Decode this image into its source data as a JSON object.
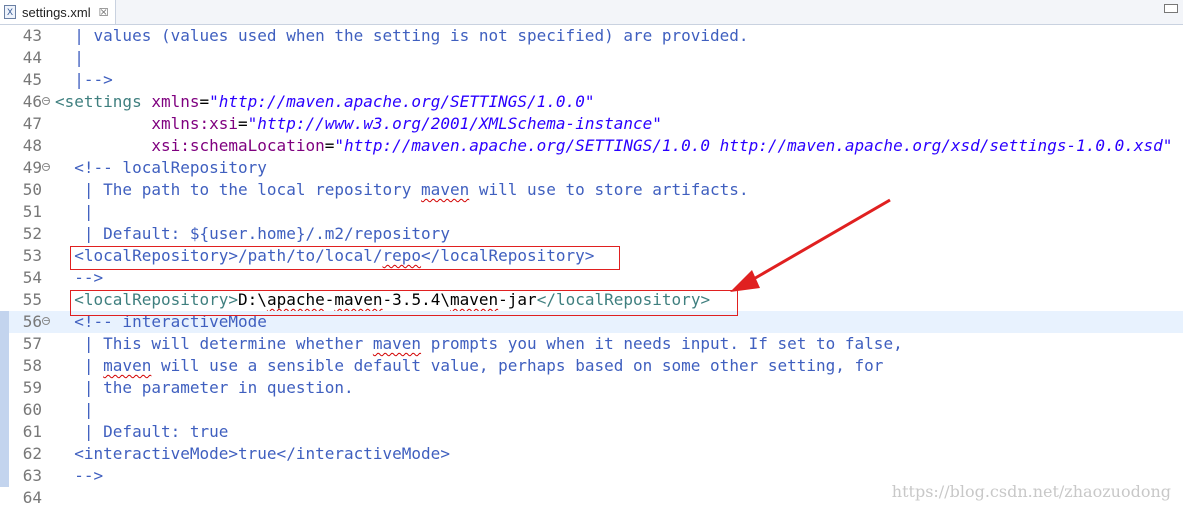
{
  "tab": {
    "label": "settings.xml",
    "close": "☒",
    "icon_letter": "X"
  },
  "lines": [
    {
      "num": "43",
      "fold": "",
      "current": false,
      "marker": false,
      "segments": [
        {
          "t": "  | values (values used when the setting is not specified) are provided.",
          "c": "c-comment"
        }
      ]
    },
    {
      "num": "44",
      "fold": "",
      "current": false,
      "marker": false,
      "segments": [
        {
          "t": "  |",
          "c": "c-comment"
        }
      ]
    },
    {
      "num": "45",
      "fold": "",
      "current": false,
      "marker": false,
      "segments": [
        {
          "t": "  |-->",
          "c": "c-comment"
        }
      ]
    },
    {
      "num": "46",
      "fold": "−",
      "current": false,
      "marker": false,
      "segments": [
        {
          "t": "<settings ",
          "c": "c-tag"
        },
        {
          "t": "xmlns",
          "c": "c-attr"
        },
        {
          "t": "=",
          "c": "c-text"
        },
        {
          "t": "\"http://maven.apache.org/SETTINGS/1.0.0\"",
          "c": "c-val"
        }
      ]
    },
    {
      "num": "47",
      "fold": "",
      "current": false,
      "marker": false,
      "segments": [
        {
          "t": "          ",
          "c": "c-text"
        },
        {
          "t": "xmlns:xsi",
          "c": "c-attr"
        },
        {
          "t": "=",
          "c": "c-text"
        },
        {
          "t": "\"http://www.w3.org/2001/XMLSchema-instance\"",
          "c": "c-val"
        }
      ]
    },
    {
      "num": "48",
      "fold": "",
      "current": false,
      "marker": false,
      "segments": [
        {
          "t": "          ",
          "c": "c-text"
        },
        {
          "t": "xsi:schemaLocation",
          "c": "c-attr"
        },
        {
          "t": "=",
          "c": "c-text"
        },
        {
          "t": "\"http://maven.apache.org/SETTINGS/1.0.0 http://maven.apache.org/xsd/settings-1.0.0.xsd\"",
          "c": "c-val"
        }
      ]
    },
    {
      "num": "49",
      "fold": "−",
      "current": false,
      "marker": false,
      "segments": [
        {
          "t": "  <!-- localRepository",
          "c": "c-comment"
        }
      ]
    },
    {
      "num": "50",
      "fold": "",
      "current": false,
      "marker": false,
      "segments": [
        {
          "t": "   | The path to the local repository ",
          "c": "c-comment"
        },
        {
          "t": "maven",
          "c": "c-comment squig"
        },
        {
          "t": " will use to store artifacts.",
          "c": "c-comment"
        }
      ]
    },
    {
      "num": "51",
      "fold": "",
      "current": false,
      "marker": false,
      "segments": [
        {
          "t": "   |",
          "c": "c-comment"
        }
      ]
    },
    {
      "num": "52",
      "fold": "",
      "current": false,
      "marker": false,
      "segments": [
        {
          "t": "   | Default: ${user.home}/.m2/repository",
          "c": "c-comment"
        }
      ]
    },
    {
      "num": "53",
      "fold": "",
      "current": false,
      "marker": false,
      "segments": [
        {
          "t": "  <localRepository>/path/to/local/",
          "c": "c-comment"
        },
        {
          "t": "repo",
          "c": "c-comment squig"
        },
        {
          "t": "</localRepository>",
          "c": "c-comment"
        }
      ]
    },
    {
      "num": "54",
      "fold": "",
      "current": false,
      "marker": false,
      "segments": [
        {
          "t": "  -->",
          "c": "c-comment"
        }
      ]
    },
    {
      "num": "55",
      "fold": "",
      "current": false,
      "marker": false,
      "segments": [
        {
          "t": "  <localRepository>",
          "c": "c-tag"
        },
        {
          "t": "D:\\",
          "c": "c-text"
        },
        {
          "t": "apache",
          "c": "c-text squig"
        },
        {
          "t": "-",
          "c": "c-text"
        },
        {
          "t": "maven",
          "c": "c-text squig"
        },
        {
          "t": "-3.5.4\\",
          "c": "c-text"
        },
        {
          "t": "maven",
          "c": "c-text squig"
        },
        {
          "t": "-jar",
          "c": "c-text"
        },
        {
          "t": "</localRepository>",
          "c": "c-tag"
        }
      ]
    },
    {
      "num": "56",
      "fold": "−",
      "current": true,
      "marker": true,
      "segments": [
        {
          "t": "  <!-- interactiveMode",
          "c": "c-comment"
        }
      ]
    },
    {
      "num": "57",
      "fold": "",
      "current": false,
      "marker": true,
      "segments": [
        {
          "t": "   | This will determine whether ",
          "c": "c-comment"
        },
        {
          "t": "maven",
          "c": "c-comment squig"
        },
        {
          "t": " prompts you when it needs input. If set to false,",
          "c": "c-comment"
        }
      ]
    },
    {
      "num": "58",
      "fold": "",
      "current": false,
      "marker": true,
      "segments": [
        {
          "t": "   | ",
          "c": "c-comment"
        },
        {
          "t": "maven",
          "c": "c-comment squig"
        },
        {
          "t": " will use a sensible default value, perhaps based on some other setting, for",
          "c": "c-comment"
        }
      ]
    },
    {
      "num": "59",
      "fold": "",
      "current": false,
      "marker": true,
      "segments": [
        {
          "t": "   | the parameter in question.",
          "c": "c-comment"
        }
      ]
    },
    {
      "num": "60",
      "fold": "",
      "current": false,
      "marker": true,
      "segments": [
        {
          "t": "   |",
          "c": "c-comment"
        }
      ]
    },
    {
      "num": "61",
      "fold": "",
      "current": false,
      "marker": true,
      "segments": [
        {
          "t": "   | Default: true",
          "c": "c-comment"
        }
      ]
    },
    {
      "num": "62",
      "fold": "",
      "current": false,
      "marker": true,
      "segments": [
        {
          "t": "  <interactiveMode>true</interactiveMode>",
          "c": "c-comment"
        }
      ]
    },
    {
      "num": "63",
      "fold": "",
      "current": false,
      "marker": true,
      "segments": [
        {
          "t": "  -->",
          "c": "c-comment"
        }
      ]
    },
    {
      "num": "64",
      "fold": "",
      "current": false,
      "marker": false,
      "segments": [
        {
          "t": "",
          "c": "c-text"
        }
      ]
    }
  ],
  "watermark": "https://blog.csdn.net/zhaozuodong",
  "colors": {
    "annotation_red": "#e02020",
    "current_line": "#e8f2fe"
  }
}
